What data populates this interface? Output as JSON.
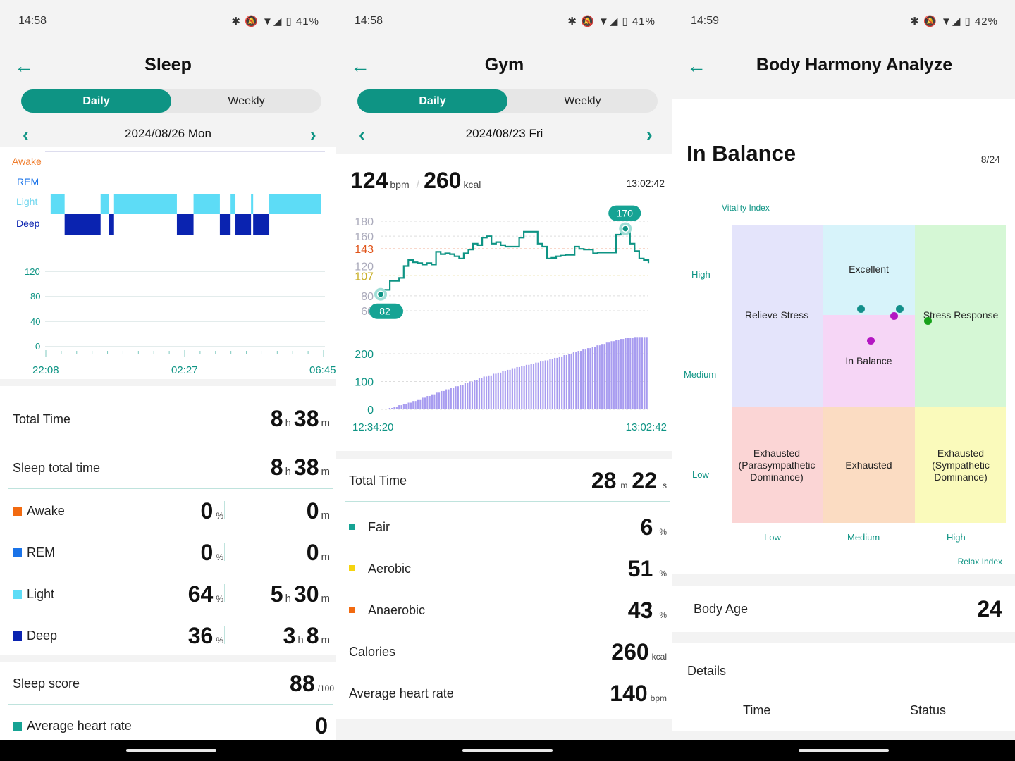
{
  "sleep": {
    "status": {
      "time": "14:58",
      "icons": "✱ 🔕 ▼◢ ▯ ",
      "battery": "41%"
    },
    "title": "Sleep",
    "tabs": {
      "daily": "Daily",
      "weekly": "Weekly"
    },
    "date": "2024/08/26 Mon",
    "stage_labels": {
      "awake": "Awake",
      "rem": "REM",
      "light": "Light",
      "deep": "Deep"
    },
    "hr_ticks": [
      "120",
      "80",
      "40",
      "0"
    ],
    "x_labels": [
      "22:08",
      "02:27",
      "06:45"
    ],
    "total_time": {
      "label": "Total Time",
      "h": "8",
      "m": "38",
      "hu": "h",
      "mu": "m"
    },
    "sleep_total": {
      "label": "Sleep total time",
      "h": "8",
      "m": "38",
      "hu": "h",
      "mu": "m"
    },
    "stages": [
      {
        "label": "Awake",
        "pct": "0",
        "time_h": "",
        "time_m": "0",
        "color": "#f26a10"
      },
      {
        "label": "REM",
        "pct": "0",
        "time_h": "",
        "time_m": "0",
        "color": "#1a73e8"
      },
      {
        "label": "Light",
        "pct": "64",
        "time_h": "5",
        "time_m": "30",
        "color": "#5ddcf6"
      },
      {
        "label": "Deep",
        "pct": "36",
        "time_h": "3",
        "time_m": "8",
        "color": "#0a23b0"
      }
    ],
    "pct_unit": "%",
    "h_unit": "h",
    "m_unit": "m",
    "score": {
      "label": "Sleep score",
      "value": "88",
      "unit": "/100"
    },
    "avg_hr": {
      "label": "Average heart rate",
      "value": "0",
      "color": "#16a394"
    },
    "chart_data": {
      "type": "timeline",
      "start": "22:08",
      "end": "06:45",
      "colors": {
        "Light": "#5ddcf6",
        "Deep": "#0a23b0"
      },
      "segments": [
        [
          "Light",
          "22:17",
          "22:43"
        ],
        [
          "Deep",
          "22:43",
          "23:50"
        ],
        [
          "Light",
          "23:50",
          "00:05"
        ],
        [
          "Deep",
          "00:05",
          "00:15"
        ],
        [
          "Light",
          "00:15",
          "02:12"
        ],
        [
          "Deep",
          "02:12",
          "02:43"
        ],
        [
          "Light",
          "02:43",
          "03:32"
        ],
        [
          "Deep",
          "03:32",
          "03:52"
        ],
        [
          "Light",
          "03:52",
          "04:01"
        ],
        [
          "Deep",
          "04:01",
          "04:30"
        ],
        [
          "Light",
          "04:30",
          "04:34"
        ],
        [
          "Deep",
          "04:34",
          "05:04"
        ],
        [
          "Light",
          "05:04",
          "06:40"
        ]
      ]
    }
  },
  "gym": {
    "status": {
      "time": "14:58",
      "icons": "✱ 🔕 ▼◢ ▯ ",
      "battery": "41%"
    },
    "title": "Gym",
    "tabs": {
      "daily": "Daily",
      "weekly": "Weekly"
    },
    "date": "2024/08/23 Fri",
    "summary": {
      "bpm": "124",
      "bpm_unit": "bpm",
      "kcal": "260",
      "kcal_unit": "kcal",
      "time": "13:02:42"
    },
    "hr_ticks": [
      "180",
      "160",
      "143",
      "120",
      "107",
      "80",
      "60"
    ],
    "cal_ticks": [
      "200",
      "100",
      "0"
    ],
    "min_label": "82",
    "max_label": "170",
    "x_labels": [
      "12:34:20",
      "13:02:42"
    ],
    "total_time": {
      "label": "Total Time",
      "m": "28",
      "s": "22",
      "mu": "m",
      "su": "s"
    },
    "zones": [
      {
        "label": "Fair",
        "value": "6",
        "unit": "%",
        "color": "#16a394"
      },
      {
        "label": "Aerobic",
        "value": "51",
        "unit": "%",
        "color": "#f5d40f"
      },
      {
        "label": "Anaerobic",
        "value": "43",
        "unit": "%",
        "color": "#f26a10"
      }
    ],
    "calories": {
      "label": "Calories",
      "value": "260",
      "unit": "kcal"
    },
    "avg_hr": {
      "label": "Average heart rate",
      "value": "140",
      "unit": "bpm"
    },
    "chart_data": [
      {
        "type": "line",
        "name": "heart rate",
        "ylim": [
          60,
          180
        ],
        "x_range": [
          "12:34:20",
          "13:02:42"
        ],
        "color": "#0e9484",
        "ref_lines": [
          {
            "y": 143,
            "color": "#e0551b"
          },
          {
            "y": 107,
            "color": "#c9b02a"
          }
        ],
        "values": [
          82,
          88,
          100,
          100,
          104,
          120,
          128,
          125,
          124,
          122,
          124,
          122,
          139,
          136,
          137,
          136,
          133,
          130,
          137,
          142,
          150,
          148,
          158,
          160,
          150,
          152,
          148,
          146,
          146,
          146,
          158,
          166,
          166,
          166,
          150,
          146,
          130,
          131,
          133,
          134,
          135,
          135,
          146,
          143,
          142,
          142,
          137,
          138,
          138,
          138,
          138,
          162,
          165,
          170,
          150,
          140,
          130,
          128,
          124
        ]
      },
      {
        "type": "bar",
        "name": "calories",
        "ylim": [
          0,
          260
        ],
        "color": "#a89cf0",
        "values": [
          2,
          5,
          10,
          15,
          20,
          24,
          30,
          36,
          42,
          48,
          54,
          60,
          66,
          72,
          78,
          83,
          88,
          95,
          100,
          106,
          112,
          118,
          122,
          128,
          132,
          138,
          142,
          148,
          152,
          156,
          160,
          164,
          168,
          172,
          176,
          180,
          185,
          190,
          195,
          200,
          205,
          210,
          215,
          220,
          225,
          230,
          235,
          240,
          245,
          250,
          253,
          256,
          258,
          260,
          260,
          260
        ]
      }
    ]
  },
  "body": {
    "status": {
      "time": "14:59",
      "icons": "✱ 🔕 ▼◢ ▯ ",
      "battery": "42%"
    },
    "title": "Body Harmony Analyze",
    "state": "In Balance",
    "count": "8/24",
    "y_axis": {
      "title": "Vitality Index",
      "ticks": [
        "High",
        "Medium",
        "Low"
      ]
    },
    "x_axis": {
      "title": "Relax Index",
      "ticks": [
        "Low",
        "Medium",
        "High"
      ]
    },
    "zones": {
      "relieve": "Relieve Stress",
      "excellent": "Excellent",
      "balance": "In Balance",
      "stress": "Stress Response",
      "ex_para": "Exhausted\n(Parasympathetic\nDominance)",
      "exhausted": "Exhausted",
      "ex_symp": "Exhausted\n(Sympathetic\nDominance)"
    },
    "zone_colors": {
      "relieve": "#e4e4fb",
      "excellent": "#d7f3fa",
      "balance": "#f6d6f6",
      "stress": "#d5f7d5",
      "ex_para": "#fbd5d5",
      "exhausted": "#fbdcc2",
      "ex_symp": "#fafabb"
    },
    "body_age": {
      "label": "Body Age",
      "value": "24"
    },
    "details": {
      "label": "Details",
      "col_time": "Time",
      "col_status": "Status"
    }
  }
}
